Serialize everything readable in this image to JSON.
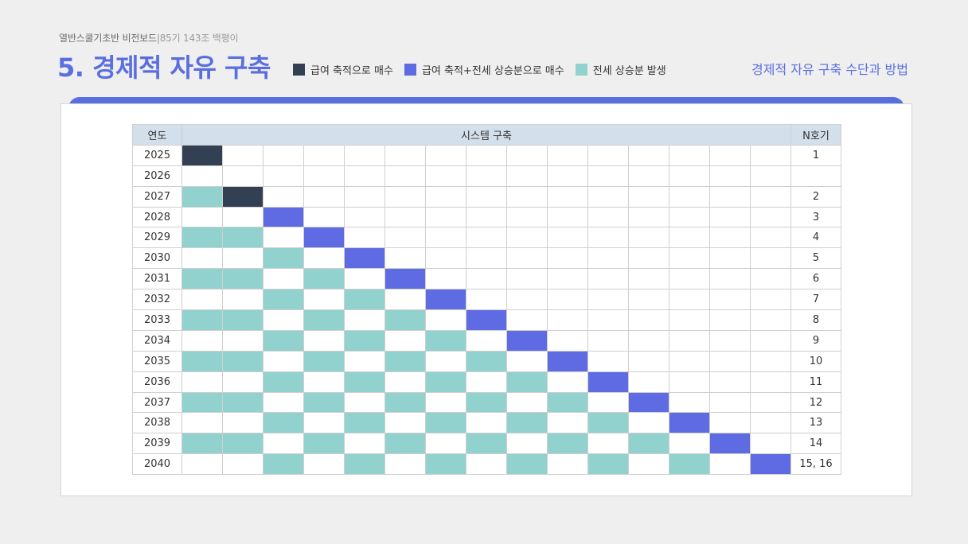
{
  "header": {
    "subtitle_main": "열반스쿨기초반 비전보드",
    "subtitle_meta": "|85기 143조 백평이",
    "title": "5. 경제적 자유 구축",
    "link": "경제적 자유 구축 수단과 방법"
  },
  "legend": [
    {
      "label": "급여 축적으로 매수",
      "color": "#333f52"
    },
    {
      "label": "급여 축적+전세 상승분으로 매수",
      "color": "#5e6be2"
    },
    {
      "label": "전세 상승분 발생",
      "color": "#91d1ce"
    }
  ],
  "table": {
    "col_year": "연도",
    "col_system": "시스템 구축",
    "col_n": "N호기",
    "rows": [
      {
        "year": "2025",
        "n": "1",
        "cells": "D..............."
      },
      {
        "year": "2026",
        "n": "",
        "cells": "..............."
      },
      {
        "year": "2027",
        "n": "2",
        "cells": "TD............."
      },
      {
        "year": "2028",
        "n": "3",
        "cells": "..B............"
      },
      {
        "year": "2029",
        "n": "4",
        "cells": "TT.B..........."
      },
      {
        "year": "2030",
        "n": "5",
        "cells": "..T.B.........."
      },
      {
        "year": "2031",
        "n": "6",
        "cells": "TT.T.B........."
      },
      {
        "year": "2032",
        "n": "7",
        "cells": "..T.T.B........"
      },
      {
        "year": "2033",
        "n": "8",
        "cells": "TT.T.T.B......."
      },
      {
        "year": "2034",
        "n": "9",
        "cells": "..T.T.T.B......"
      },
      {
        "year": "2035",
        "n": "10",
        "cells": "TT.T.T.T.B....."
      },
      {
        "year": "2036",
        "n": "11",
        "cells": "..T.T.T.T.B...."
      },
      {
        "year": "2037",
        "n": "12",
        "cells": "TT.T.T.T.T.B..."
      },
      {
        "year": "2038",
        "n": "13",
        "cells": "..T.T.T.T.T.B.."
      },
      {
        "year": "2039",
        "n": "14",
        "cells": "TT.T.T.T.T.T.B."
      },
      {
        "year": "2040",
        "n": "15, 16",
        "cells": "..T.T.T.T.T.T.B"
      }
    ]
  }
}
